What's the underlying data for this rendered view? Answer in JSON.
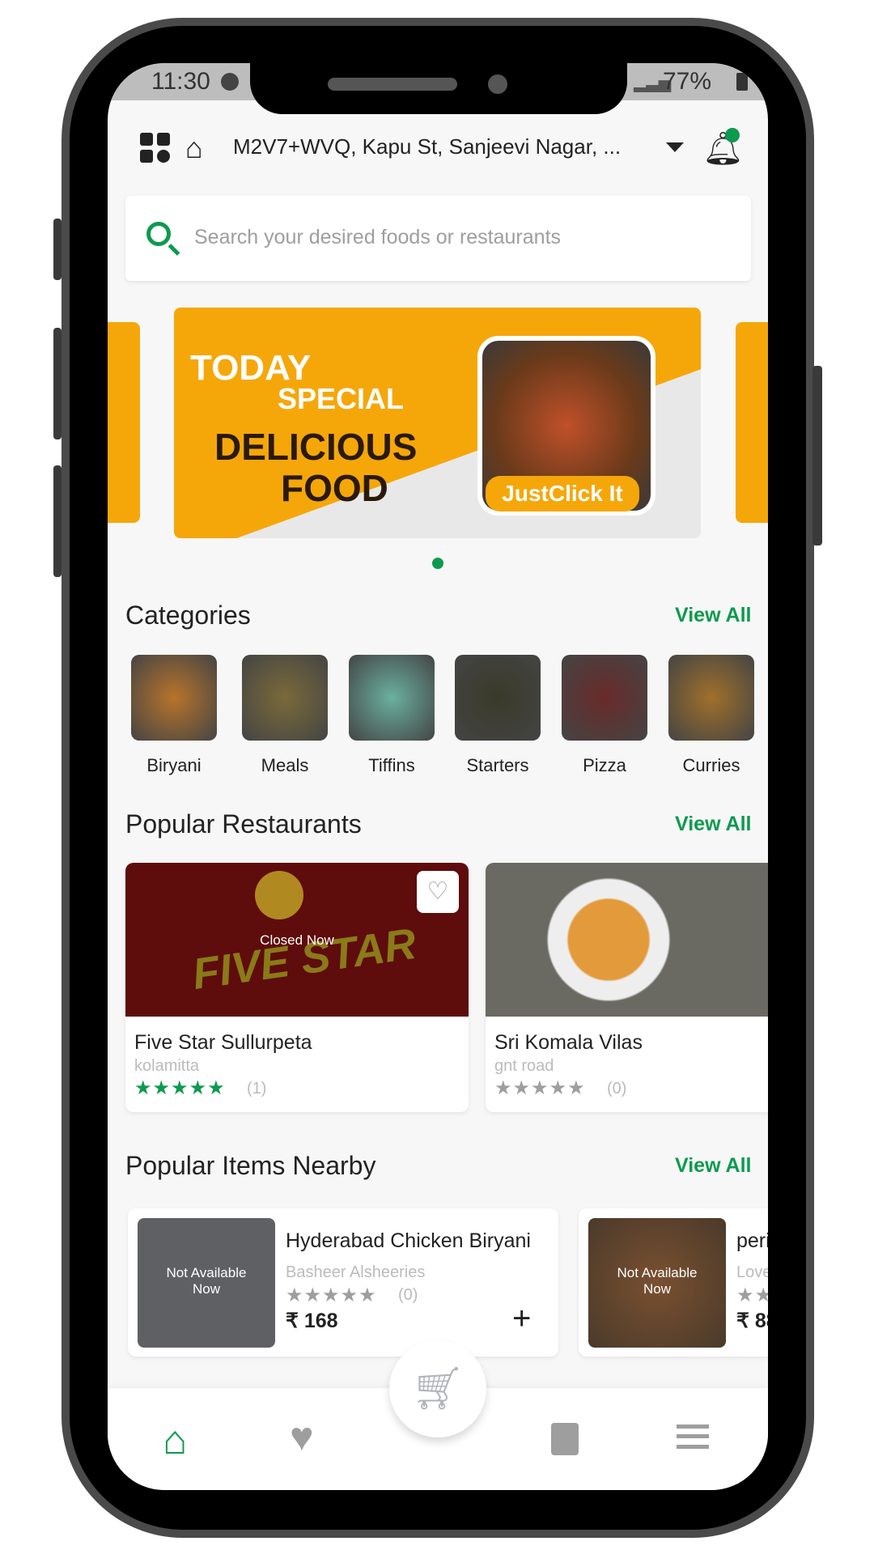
{
  "status_bar": {
    "time": "11:30",
    "battery": "77%"
  },
  "header": {
    "address": "M2V7+WVQ, Kapu St, Sanjeevi Nagar, ...",
    "notification_dot_color": "#0d9a4e"
  },
  "search": {
    "placeholder": "Search your desired foods or restaurants"
  },
  "banner": {
    "line1": "TODAY",
    "line2": "SPECIAL",
    "line3": "DELICIOUS",
    "line4": "FOOD",
    "badge": "JustClick It",
    "bg_color": "#f5a70a",
    "page": 1,
    "pages": 1
  },
  "categories": {
    "title": "Categories",
    "view_all": "View All",
    "items": [
      {
        "label": "Biryani"
      },
      {
        "label": "Meals"
      },
      {
        "label": "Tiffins"
      },
      {
        "label": "Starters"
      },
      {
        "label": "Pizza"
      },
      {
        "label": "Curries"
      }
    ]
  },
  "restaurants": {
    "title": "Popular Restaurants",
    "view_all": "View All",
    "items": [
      {
        "name": "Five Star Sullurpeta",
        "location": "kolamitta",
        "rating": 5,
        "reviews": "(1)",
        "status": "Closed Now",
        "logo_text": "FIVE STAR"
      },
      {
        "name": "Sri Komala Vilas",
        "location": "gnt road",
        "rating": 0,
        "reviews": "(0)"
      }
    ]
  },
  "popular_items": {
    "title": "Popular Items Nearby",
    "view_all": "View All",
    "items": [
      {
        "name": "Hyderabad Chicken Biryani",
        "restaurant": "Basheer Alsheeries",
        "rating": 0,
        "reviews": "(0)",
        "price": "₹ 168",
        "overlay": "Not Available Now"
      },
      {
        "name": "peri",
        "restaurant": "Love",
        "price": "₹ 88",
        "overlay": "Not Available Now"
      }
    ]
  },
  "bottom_nav": {
    "active": "home",
    "accent": "#0d9a4e",
    "items": [
      "home",
      "favourites",
      "cart",
      "orders",
      "menu"
    ]
  }
}
